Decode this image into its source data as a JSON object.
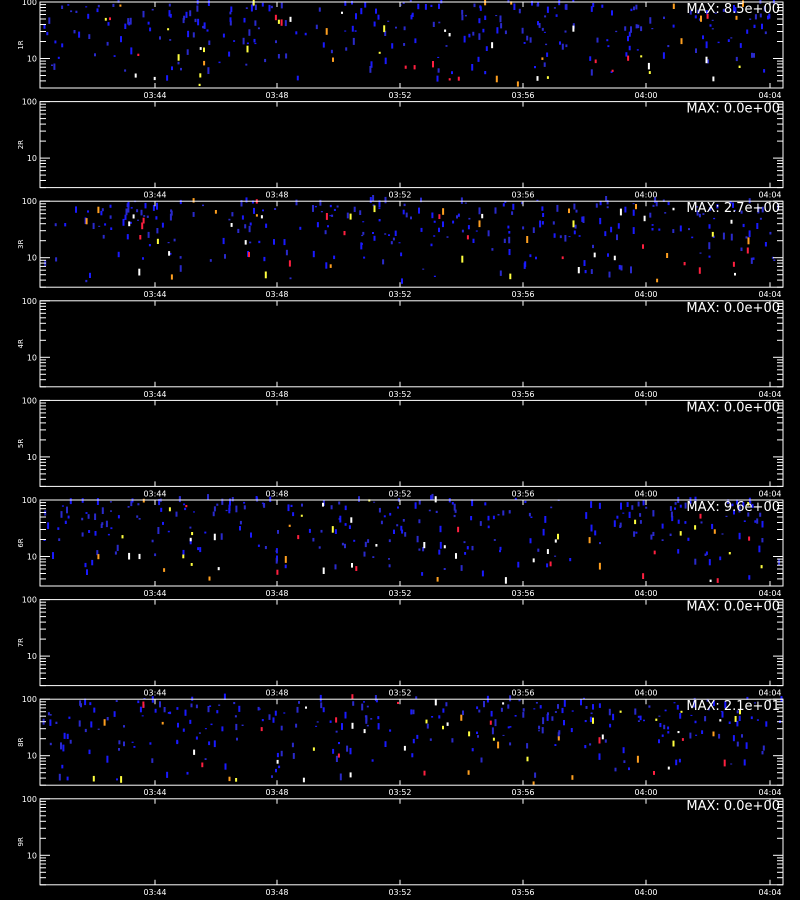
{
  "footer": "",
  "chart_data": [
    {
      "type": "heatmap",
      "panel_label": "1R",
      "max_label": "MAX: 8.5e+00",
      "yticks": [
        {
          "value": 100,
          "label": "100"
        },
        {
          "value": 10,
          "label": "10"
        }
      ],
      "xticks": [
        "03:44",
        "03:48",
        "03:52",
        "03:56",
        "04:00",
        "04:04"
      ],
      "y_scale": "log",
      "intensity": "sparse",
      "has_data": true
    },
    {
      "type": "heatmap",
      "panel_label": "2R",
      "max_label": "MAX: 0.0e+00",
      "yticks": [
        {
          "value": 100,
          "label": "100"
        },
        {
          "value": 10,
          "label": "10"
        }
      ],
      "xticks": [
        "03:44",
        "03:48",
        "03:52",
        "03:56",
        "04:00",
        "04:04"
      ],
      "y_scale": "log",
      "intensity": "none",
      "has_data": false
    },
    {
      "type": "heatmap",
      "panel_label": "3R",
      "max_label": "MAX: 2.7e+00",
      "yticks": [
        {
          "value": 100,
          "label": "100"
        },
        {
          "value": 10,
          "label": "10"
        }
      ],
      "xticks": [
        "03:44",
        "03:48",
        "03:52",
        "03:56",
        "04:00",
        "04:04"
      ],
      "y_scale": "log",
      "intensity": "sparse",
      "has_data": true
    },
    {
      "type": "heatmap",
      "panel_label": "4R",
      "max_label": "MAX: 0.0e+00",
      "yticks": [
        {
          "value": 100,
          "label": "100"
        },
        {
          "value": 10,
          "label": "10"
        }
      ],
      "xticks": [
        "03:44",
        "03:48",
        "03:52",
        "03:56",
        "04:00",
        "04:04"
      ],
      "y_scale": "log",
      "intensity": "none",
      "has_data": false
    },
    {
      "type": "heatmap",
      "panel_label": "5R",
      "max_label": "MAX: 0.0e+00",
      "yticks": [
        {
          "value": 100,
          "label": "100"
        },
        {
          "value": 10,
          "label": "10"
        }
      ],
      "xticks": [
        "03:44",
        "03:48",
        "03:52",
        "03:56",
        "04:00",
        "04:04"
      ],
      "y_scale": "log",
      "intensity": "none",
      "has_data": false
    },
    {
      "type": "heatmap",
      "panel_label": "6R",
      "max_label": "MAX: 9.6e+00",
      "yticks": [
        {
          "value": 100,
          "label": "100"
        },
        {
          "value": 10,
          "label": "10"
        }
      ],
      "xticks": [
        "03:44",
        "03:48",
        "03:52",
        "03:56",
        "04:00",
        "04:04"
      ],
      "y_scale": "log",
      "intensity": "sparse",
      "has_data": true
    },
    {
      "type": "heatmap",
      "panel_label": "7R",
      "max_label": "MAX: 0.0e+00",
      "yticks": [
        {
          "value": 100,
          "label": "100"
        },
        {
          "value": 10,
          "label": "10"
        }
      ],
      "xticks": [
        "03:44",
        "03:48",
        "03:52",
        "03:56",
        "04:00",
        "04:04"
      ],
      "y_scale": "log",
      "intensity": "none",
      "has_data": false
    },
    {
      "type": "heatmap",
      "panel_label": "8R",
      "max_label": "MAX: 2.1e+01",
      "yticks": [
        {
          "value": 100,
          "label": "100"
        },
        {
          "value": 10,
          "label": "10"
        }
      ],
      "xticks": [
        "03:44",
        "03:48",
        "03:52",
        "03:56",
        "04:00",
        "04:04"
      ],
      "y_scale": "log",
      "intensity": "sparse",
      "has_data": true
    },
    {
      "type": "heatmap",
      "panel_label": "9R",
      "max_label": "MAX: 0.0e+00",
      "yticks": [
        {
          "value": 100,
          "label": "100"
        },
        {
          "value": 10,
          "label": "10"
        }
      ],
      "xticks": [
        "03:44",
        "03:48",
        "03:52",
        "03:56",
        "04:00",
        "04:04"
      ],
      "y_scale": "log",
      "intensity": "none",
      "has_data": false
    }
  ],
  "colors": {
    "background": "#000000",
    "axis": "#ffffff",
    "text": "#ffffff",
    "palette": [
      "#1a1aff",
      "#2a2acc",
      "#ff2040",
      "#ffa020",
      "#ffff40",
      "#ffffff"
    ]
  }
}
